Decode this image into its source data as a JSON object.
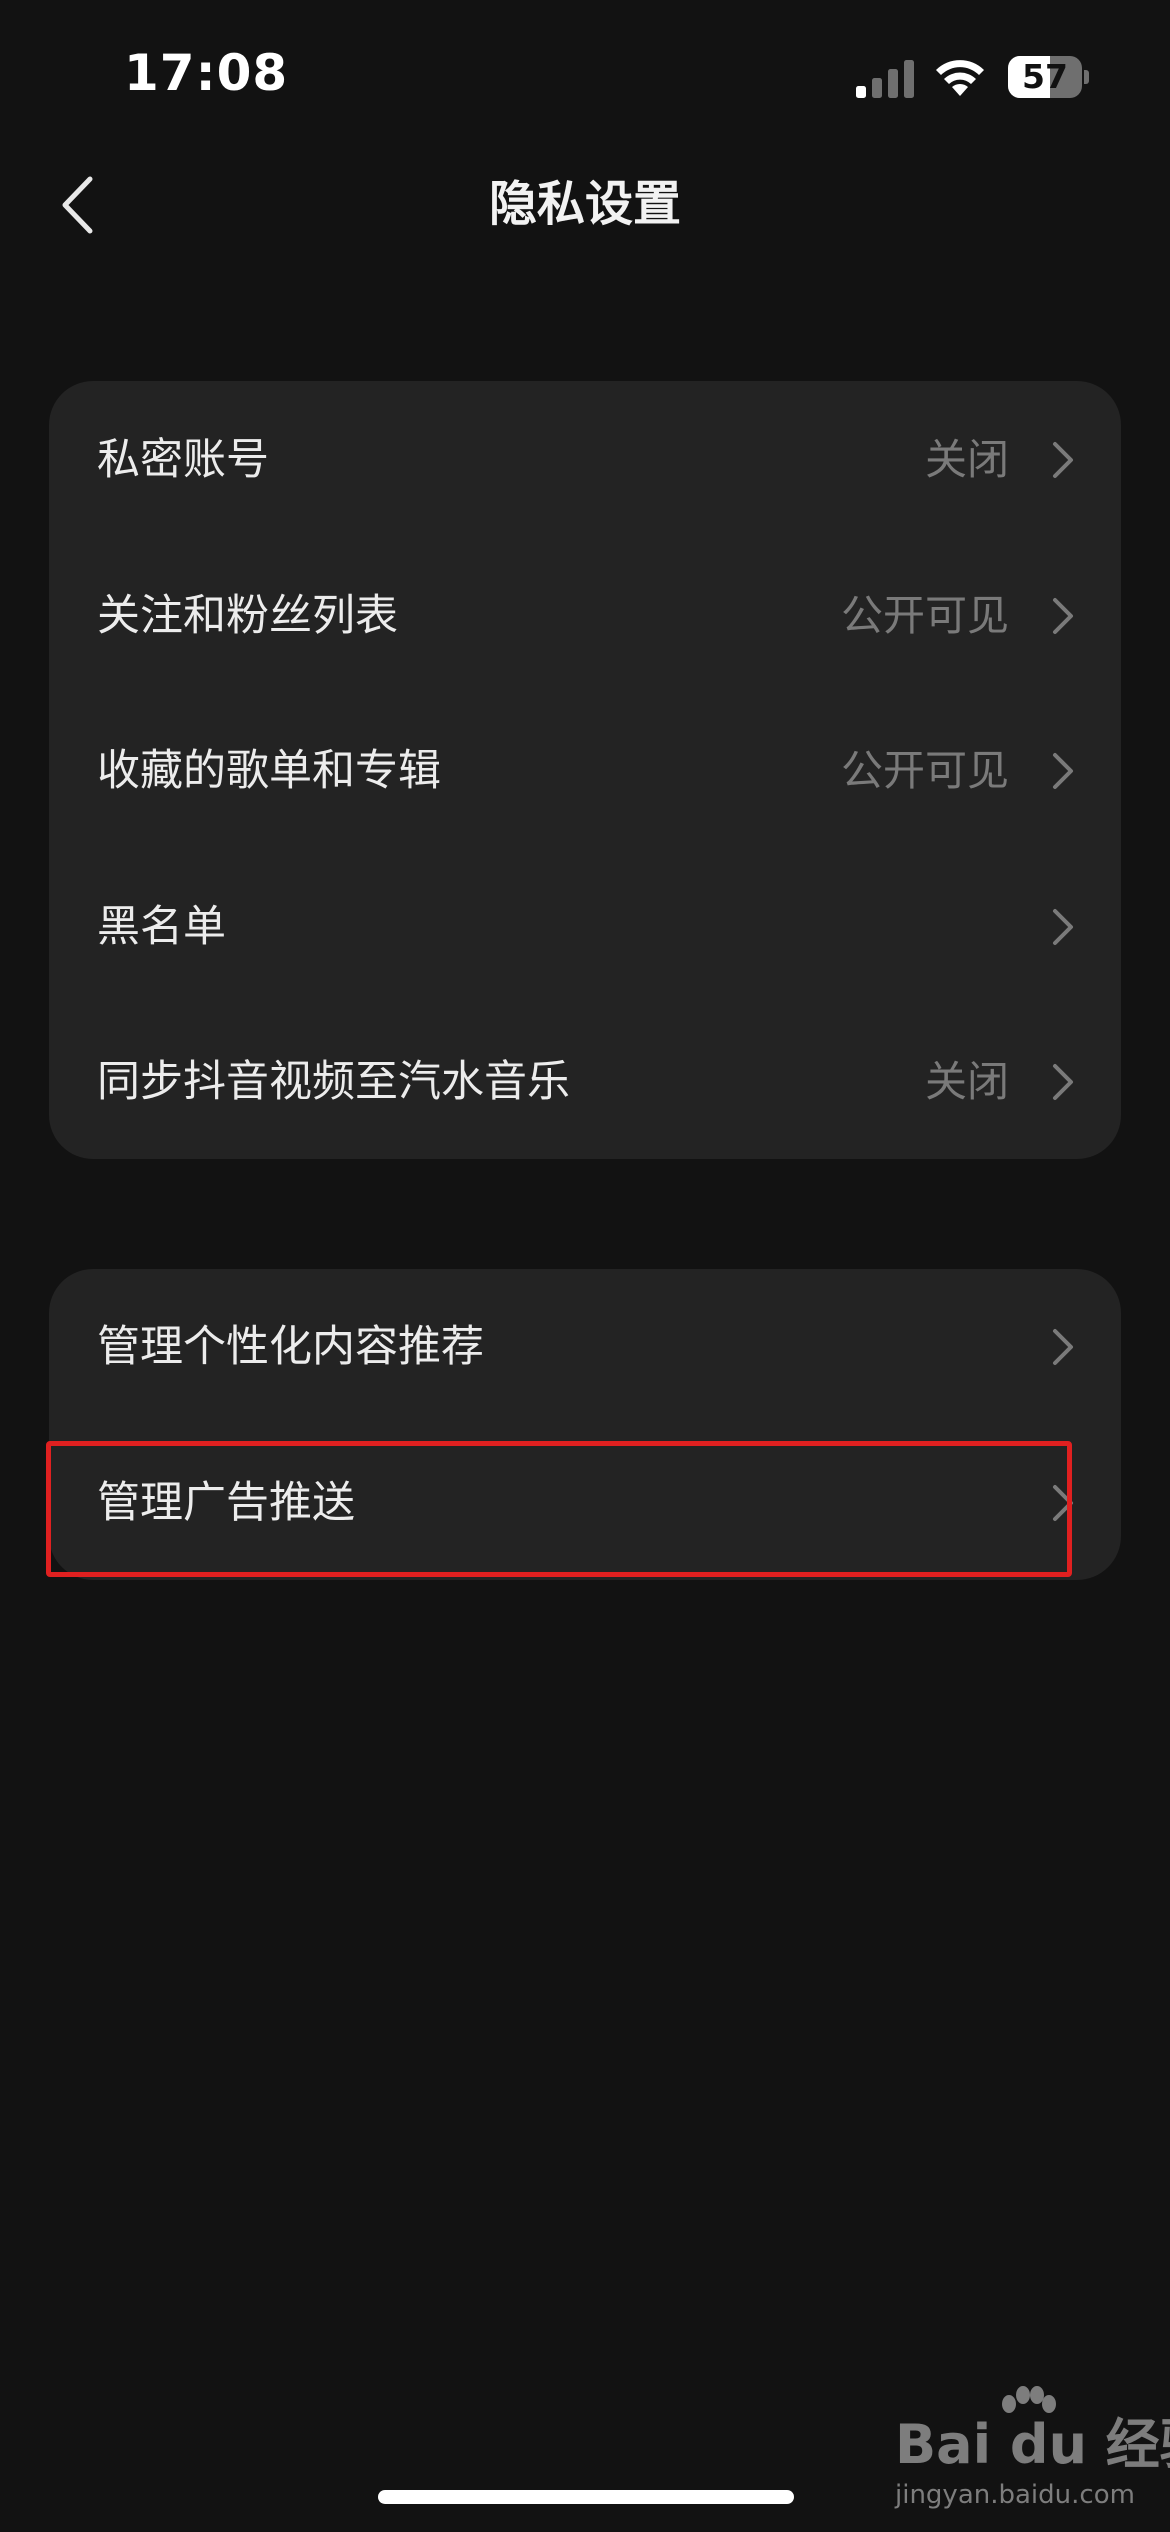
{
  "status_bar": {
    "time": "17:08",
    "battery": {
      "level_text": "57",
      "level_fraction": 0.57
    },
    "signal_icon": "cellular-signal-icon",
    "wifi_icon": "wifi-icon"
  },
  "nav": {
    "title": "隐私设置",
    "back_icon": "chevron-left-icon"
  },
  "sections": [
    {
      "items": [
        {
          "label": "私密账号",
          "value": "关闭"
        },
        {
          "label": "关注和粉丝列表",
          "value": "公开可见"
        },
        {
          "label": "收藏的歌单和专辑",
          "value": "公开可见"
        },
        {
          "label": "黑名单",
          "value": ""
        },
        {
          "label": "同步抖音视频至汽水音乐",
          "value": "关闭"
        }
      ]
    },
    {
      "items": [
        {
          "label": "管理个性化内容推荐",
          "value": ""
        },
        {
          "label": "管理广告推送",
          "value": "",
          "highlighted": true
        }
      ]
    }
  ],
  "watermark": {
    "logo": "Bai du 经验",
    "url": "jingyan.baidu.com"
  },
  "colors": {
    "background": "#121212",
    "card": "#232323",
    "label": "#ececec",
    "value": "#7a7a7a",
    "highlight": "#e02020"
  }
}
